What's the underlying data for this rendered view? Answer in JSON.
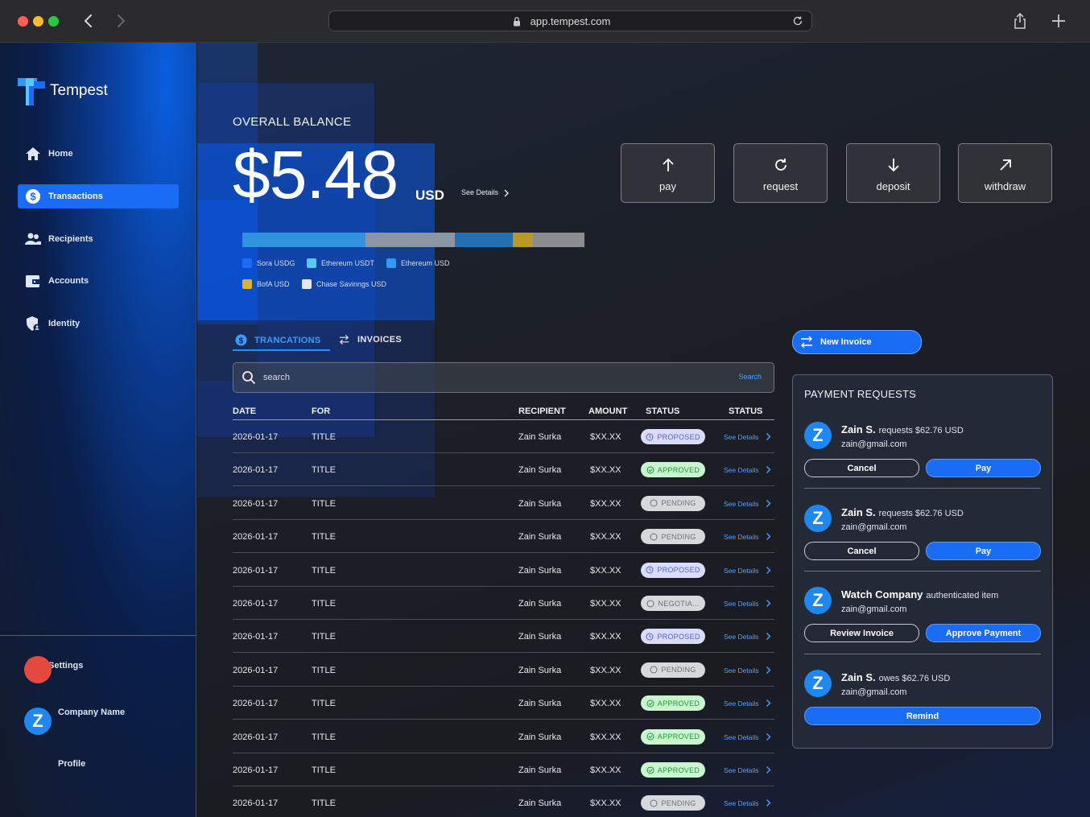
{
  "browser": {
    "url": "app.tempest.com"
  },
  "brand": {
    "name": "Tempest",
    "accent": "#1a6cf5"
  },
  "sidebar": {
    "items": [
      {
        "label": "Home",
        "icon": "home-icon"
      },
      {
        "label": "Transactions",
        "icon": "dollar-icon",
        "active": true
      },
      {
        "label": "Recipients",
        "icon": "users-icon"
      },
      {
        "label": "Accounts",
        "icon": "wallet-icon"
      },
      {
        "label": "Identity",
        "icon": "shield-user-icon"
      }
    ],
    "settings": "Settings",
    "company": "Company Name",
    "profile": "Profile",
    "profile_initial": "Z"
  },
  "balance": {
    "label": "OVERALL BALANCE",
    "amount": "$5.48",
    "currency": "USD",
    "see_details": "See Details",
    "distribution": [
      {
        "name": "Sora USDG",
        "color": "#2f93dd",
        "fraction": 0.36
      },
      {
        "name": "Chase Savinngs USD",
        "color": "#8c95a3",
        "fraction": 0.26
      },
      {
        "name": "Ethereum USD",
        "color": "#2470b0",
        "fraction": 0.17
      },
      {
        "name": "BofA USD",
        "color": "#b79a2a",
        "fraction": 0.06
      },
      {
        "name": "Chase Savinngs USD",
        "color": "#8a8d92",
        "fraction": 0.15
      }
    ],
    "legend": [
      {
        "name": "Sora USDG",
        "color": "#1a6cf5"
      },
      {
        "name": "Ethereum USDT",
        "color": "#58c8f5"
      },
      {
        "name": "Ethereum USD",
        "color": "#2e9bf0"
      },
      {
        "name": "BofA USD",
        "color": "#e0b227"
      },
      {
        "name": "Chase Savinngs USD",
        "color": "#e6e8ec"
      }
    ]
  },
  "actions": [
    {
      "label": "pay",
      "icon": "arrow-up-icon"
    },
    {
      "label": "request",
      "icon": "refresh-icon"
    },
    {
      "label": "deposit",
      "icon": "arrow-down-icon"
    },
    {
      "label": "withdraw",
      "icon": "arrow-up-right-icon"
    }
  ],
  "tabs": {
    "transactions": "TRANCATIONS",
    "invoices": "INVOICES"
  },
  "search": {
    "placeholder": "search",
    "button": "Search"
  },
  "table": {
    "headers": [
      "DATE",
      "FOR",
      "RECIPIENT",
      "AMOUNT",
      "STATUS",
      "STATUS"
    ],
    "see_details": "See Details",
    "rows": [
      {
        "date": "2026-01-17",
        "for": "TITLE",
        "recipient": "Zain Surka",
        "amount": "$XX.XX",
        "status": "PROPOSED",
        "kind": "proposed"
      },
      {
        "date": "2026-01-17",
        "for": "TITLE",
        "recipient": "Zain Surka",
        "amount": "$XX.XX",
        "status": "APPROVED",
        "kind": "approved"
      },
      {
        "date": "2026-01-17",
        "for": "TITLE",
        "recipient": "Zain Surka",
        "amount": "$XX.XX",
        "status": "PENDING",
        "kind": "pending"
      },
      {
        "date": "2026-01-17",
        "for": "TITLE",
        "recipient": "Zain Surka",
        "amount": "$XX.XX",
        "status": "PENDING",
        "kind": "pending"
      },
      {
        "date": "2026-01-17",
        "for": "TITLE",
        "recipient": "Zain Surka",
        "amount": "$XX.XX",
        "status": "PROPOSED",
        "kind": "proposed"
      },
      {
        "date": "2026-01-17",
        "for": "TITLE",
        "recipient": "Zain Surka",
        "amount": "$XX.XX",
        "status": "NEGOTIA...",
        "kind": "negotia"
      },
      {
        "date": "2026-01-17",
        "for": "TITLE",
        "recipient": "Zain Surka",
        "amount": "$XX.XX",
        "status": "PROPOSED",
        "kind": "proposed"
      },
      {
        "date": "2026-01-17",
        "for": "TITLE",
        "recipient": "Zain Surka",
        "amount": "$XX.XX",
        "status": "PENDING",
        "kind": "pending"
      },
      {
        "date": "2026-01-17",
        "for": "TITLE",
        "recipient": "Zain Surka",
        "amount": "$XX.XX",
        "status": "APPROVED",
        "kind": "approved"
      },
      {
        "date": "2026-01-17",
        "for": "TITLE",
        "recipient": "Zain Surka",
        "amount": "$XX.XX",
        "status": "APPROVED",
        "kind": "approved"
      },
      {
        "date": "2026-01-17",
        "for": "TITLE",
        "recipient": "Zain Surka",
        "amount": "$XX.XX",
        "status": "APPROVED",
        "kind": "approved"
      },
      {
        "date": "2026-01-17",
        "for": "TITLE",
        "recipient": "Zain Surka",
        "amount": "$XX.XX",
        "status": "PENDING",
        "kind": "pending"
      }
    ]
  },
  "new_invoice": "New Invoice",
  "payment_requests": {
    "title": "PAYMENT REQUESTS",
    "items": [
      {
        "initial": "Z",
        "name": "Zain S.",
        "text": "requests $62.76 USD",
        "email": "zain@gmail.com",
        "buttons": [
          "Cancel",
          "Pay"
        ]
      },
      {
        "initial": "Z",
        "name": "Zain S.",
        "text": "requests $62.76 USD",
        "email": "zain@gmail.com",
        "buttons": [
          "Cancel",
          "Pay"
        ]
      },
      {
        "initial": "Z",
        "name": "Watch Company",
        "text": "authenticated item",
        "email": "zain@gmail.com",
        "buttons": [
          "Review Invoice",
          "Approve Payment"
        ]
      },
      {
        "initial": "Z",
        "name": "Zain S.",
        "text": "owes $62.76 USD",
        "email": "zain@gmail.com",
        "buttons": [
          "Remind"
        ]
      }
    ]
  }
}
